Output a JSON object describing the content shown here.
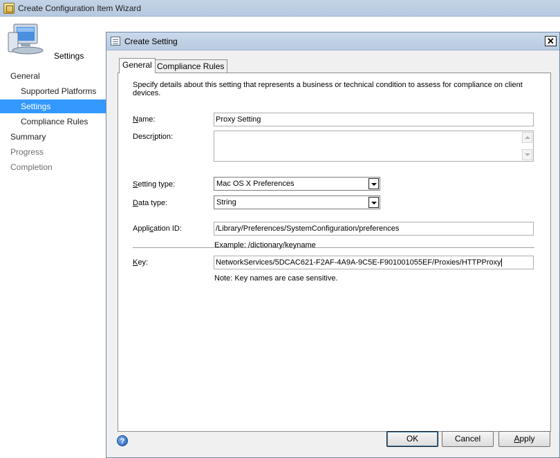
{
  "wizard": {
    "title": "Create Configuration Item Wizard",
    "header_title": "Settings",
    "nav": [
      {
        "label": "General",
        "level": "top",
        "state": "normal"
      },
      {
        "label": "Supported Platforms",
        "level": "sub",
        "state": "normal"
      },
      {
        "label": "Settings",
        "level": "sub",
        "state": "selected"
      },
      {
        "label": "Compliance Rules",
        "level": "sub",
        "state": "normal"
      },
      {
        "label": "Summary",
        "level": "top",
        "state": "normal"
      },
      {
        "label": "Progress",
        "level": "top",
        "state": "disabled"
      },
      {
        "label": "Completion",
        "level": "top",
        "state": "disabled"
      }
    ]
  },
  "dialog": {
    "title": "Create Setting",
    "close_label": "✕",
    "tabs": [
      {
        "label": "General",
        "active": true
      },
      {
        "label": "Compliance Rules",
        "active": false
      }
    ],
    "intro": "Specify details about this setting that represents a business or technical condition to assess for compliance on client devices.",
    "name_label_accel": "N",
    "name_label_rest": "ame:",
    "name_value": "Proxy Setting",
    "description_label_pre": "Descr",
    "description_label_accel": "i",
    "description_label_rest": "ption:",
    "description_value": "",
    "setting_type_label_accel": "S",
    "setting_type_label_rest": "etting type:",
    "setting_type_value": "Mac OS X Preferences",
    "data_type_label_accel": "D",
    "data_type_label_rest": "ata type:",
    "data_type_value": "String",
    "app_id_label_pre": "Appli",
    "app_id_label_accel": "c",
    "app_id_label_rest": "ation ID:",
    "app_id_value": "/Library/Preferences/SystemConfiguration/preferences",
    "app_id_hint": "Example: /dictionary/keyname",
    "key_label_accel": "K",
    "key_label_rest": "ey:",
    "key_value": "NetworkServices/5DCAC621-F2AF-4A9A-9C5E-F901001055EF/Proxies/HTTPProxy",
    "key_hint": "Note: Key names are case sensitive.",
    "help_glyph": "?",
    "ok_label": "OK",
    "cancel_label": "Cancel",
    "apply_accel": "A",
    "apply_rest": "pply"
  },
  "colors": {
    "selected_nav": "#3399ff",
    "dialog_bg": "#f0f0f0",
    "titlebar": "#b9cbe1"
  }
}
